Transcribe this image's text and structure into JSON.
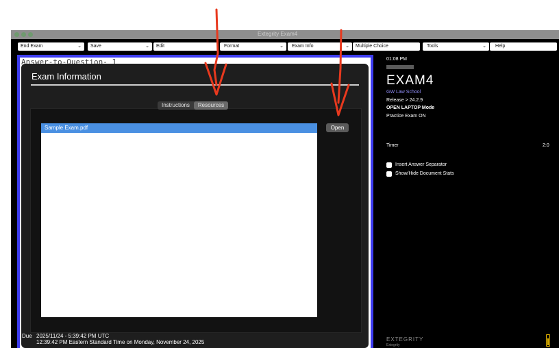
{
  "window": {
    "title": "Extegrity Exam4"
  },
  "toolbar": {
    "end_exam": "End Exam",
    "save": "Save",
    "edit": "Edit",
    "format": "Format",
    "exam_info": "Exam Info",
    "multiple_choice": "Multiple Choice",
    "tools": "Tools",
    "help": "Help"
  },
  "editor": {
    "answer_text": "Answer-to-Question- 1"
  },
  "dialog": {
    "title": "Exam Information",
    "tabs": [
      "Instructions",
      "Resources"
    ],
    "selected_tab": "Resources",
    "files": [
      "Sample Exam.pdf"
    ],
    "open_label": "Open"
  },
  "due": {
    "label": "Due",
    "line1": "2025/11/24 - 5:39:42 PM UTC",
    "line2": "12:39:42 PM Eastern Standard Time on Monday, November 24, 2025"
  },
  "side": {
    "time": "01:08 PM",
    "logo": "EXAM4",
    "school": "GW Law School",
    "release": "Release > 24.2.9",
    "mode": "OPEN LAPTOP Mode",
    "practice": "Practice Exam ON",
    "timer_label": "Timer",
    "timer_value": "2:0",
    "opt_separator": "Insert Answer Separator",
    "opt_stats": "Show/Hide Document Stats",
    "brand": "EXTEGRITY",
    "brand_sub": "Extegrity"
  },
  "colors": {
    "editor_border": "#3d3cf0",
    "selection": "#4a90e2",
    "school": "#8f8cf5",
    "annotation": "#e8391e",
    "battery": "#f0c000"
  }
}
